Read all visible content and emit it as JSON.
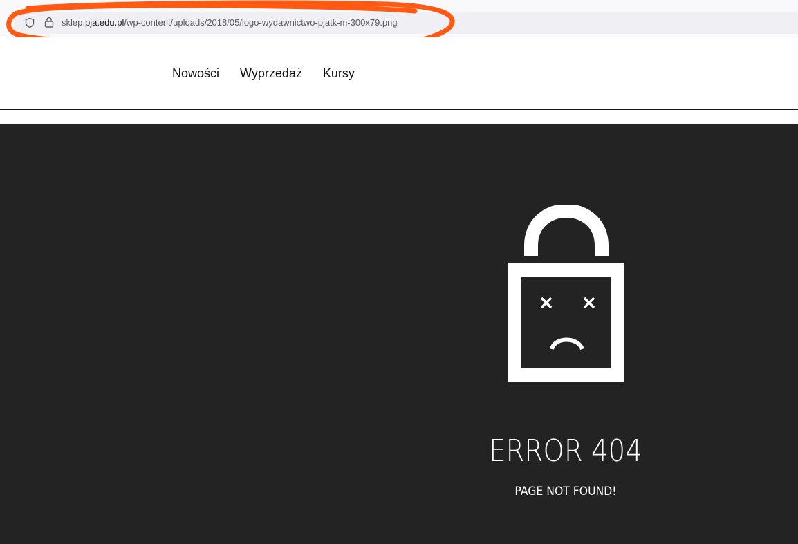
{
  "browser": {
    "url_prefix": "sklep.",
    "url_domain": "pja.edu.pl",
    "url_path": "/wp-content/uploads/2018/05/logo-wydawnictwo-pjatk-m-300x79.png",
    "annotation_color": "#ff5a14"
  },
  "nav": {
    "items": [
      {
        "label": "Nowości"
      },
      {
        "label": "Wyprzedaż"
      },
      {
        "label": "Kursy"
      }
    ]
  },
  "error": {
    "title": "ERROR 404",
    "subtitle": "PAGE NOT FOUND!",
    "background_color": "#232323",
    "icon": "sad-padlock-icon"
  }
}
